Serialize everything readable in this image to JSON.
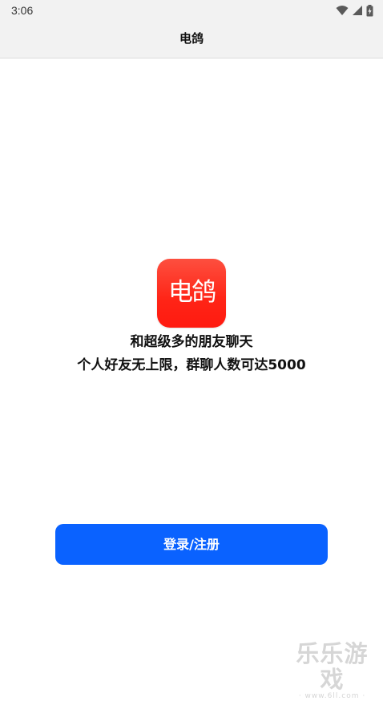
{
  "status_bar": {
    "time": "3:06",
    "icons": [
      "wifi-icon",
      "signal-icon",
      "battery-charging-icon"
    ]
  },
  "header": {
    "title": "电鸽"
  },
  "logo": {
    "text": "电鸽",
    "color_top": "#fd4f3f",
    "color_bottom": "#ff1a10"
  },
  "tagline": {
    "line1": "和超级多的朋友聊天",
    "line2": "个人好友无上限，群聊人数可达5000"
  },
  "actions": {
    "login_label": "登录/注册",
    "login_color": "#0a62ff"
  },
  "watermark": {
    "main": "乐乐游戏",
    "sub": "· www.6ll.com ·"
  }
}
